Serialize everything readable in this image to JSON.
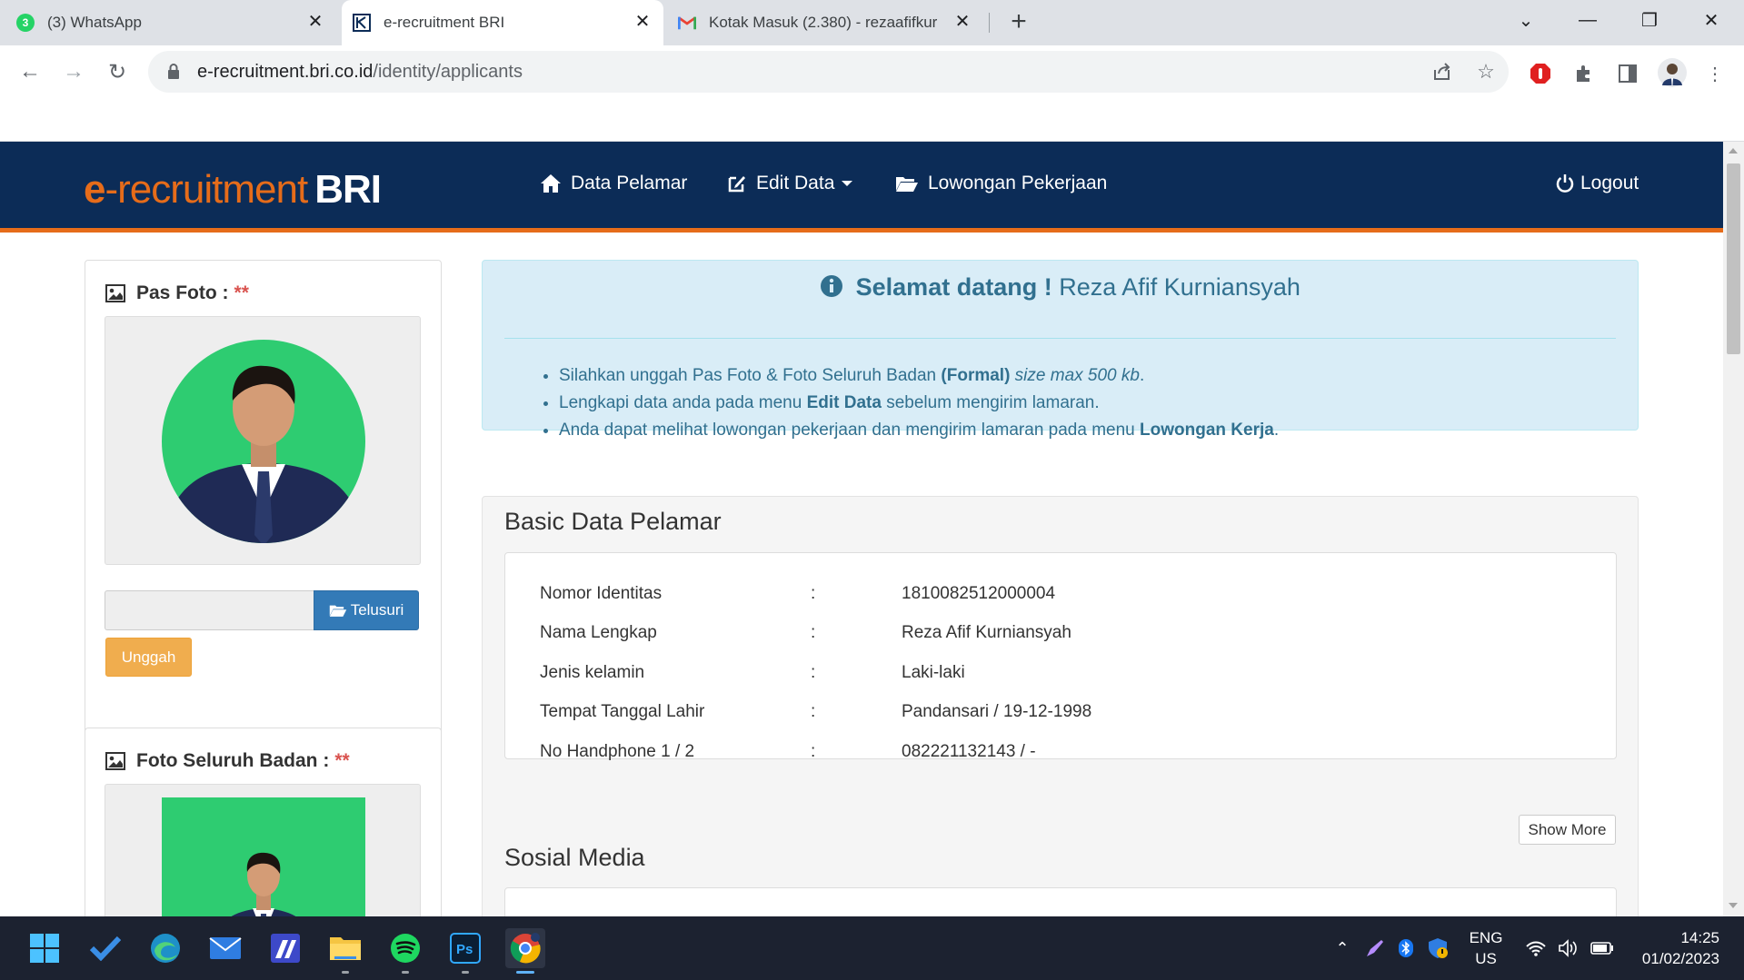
{
  "browser": {
    "tabs": [
      {
        "label": "(3) WhatsApp",
        "badge": "3",
        "icon": "whatsapp-icon"
      },
      {
        "label": "e-recruitment BRI",
        "icon": "bri-icon"
      },
      {
        "label": "Kotak Masuk (2.380) - rezaafifkur",
        "icon": "gmail-icon"
      }
    ],
    "address": {
      "domain": "e-recruitment.bri.co.id",
      "path": "/identity/applicants"
    }
  },
  "site": {
    "brand": {
      "prefix": "e",
      "middle": "-recruitment",
      "suffix": "BRI"
    },
    "nav": {
      "data_pelamar": "Data Pelamar",
      "edit_data": "Edit Data",
      "lowongan": "Lowongan Pekerjaan",
      "logout": "Logout"
    },
    "pas_foto": {
      "title": "Pas Foto :",
      "required": "**",
      "browse": "Telusuri",
      "upload": "Unggah"
    },
    "foto_badan": {
      "title": "Foto Seluruh Badan :",
      "required": "**"
    },
    "welcome": {
      "greeting": "Selamat datang !",
      "name": "Reza Afif Kurniansyah",
      "items": [
        {
          "text1": "Silahkan unggah Pas Foto & Foto Seluruh Badan ",
          "bold": "(Formal)",
          "italic": " size max 500 kb",
          "text2": "."
        },
        {
          "text1": "Lengkapi data anda pada menu ",
          "bold": "Edit Data",
          "text2": " sebelum mengirim lamaran."
        },
        {
          "text1": "Anda dapat melihat lowongan pekerjaan dan mengirim lamaran pada menu ",
          "bold": "Lowongan Kerja",
          "text2": "."
        }
      ]
    },
    "basic_data": {
      "title": "Basic Data Pelamar",
      "separator": ":",
      "rows": [
        {
          "label": "Nomor Identitas",
          "value": "1810082512000004"
        },
        {
          "label": "Nama Lengkap",
          "value": "Reza Afif Kurniansyah"
        },
        {
          "label": "Jenis kelamin",
          "value": "Laki-laki"
        },
        {
          "label": "Tempat Tanggal Lahir",
          "value": "Pandansari / 19-12-1998"
        },
        {
          "label": "No Handphone 1 / 2",
          "value": "082221132143 / -"
        }
      ],
      "show_more": "Show More"
    },
    "social": {
      "title": "Sosial Media"
    }
  },
  "taskbar": {
    "lang": "ENG",
    "region": "US",
    "time": "14:25",
    "date": "01/02/2023"
  }
}
